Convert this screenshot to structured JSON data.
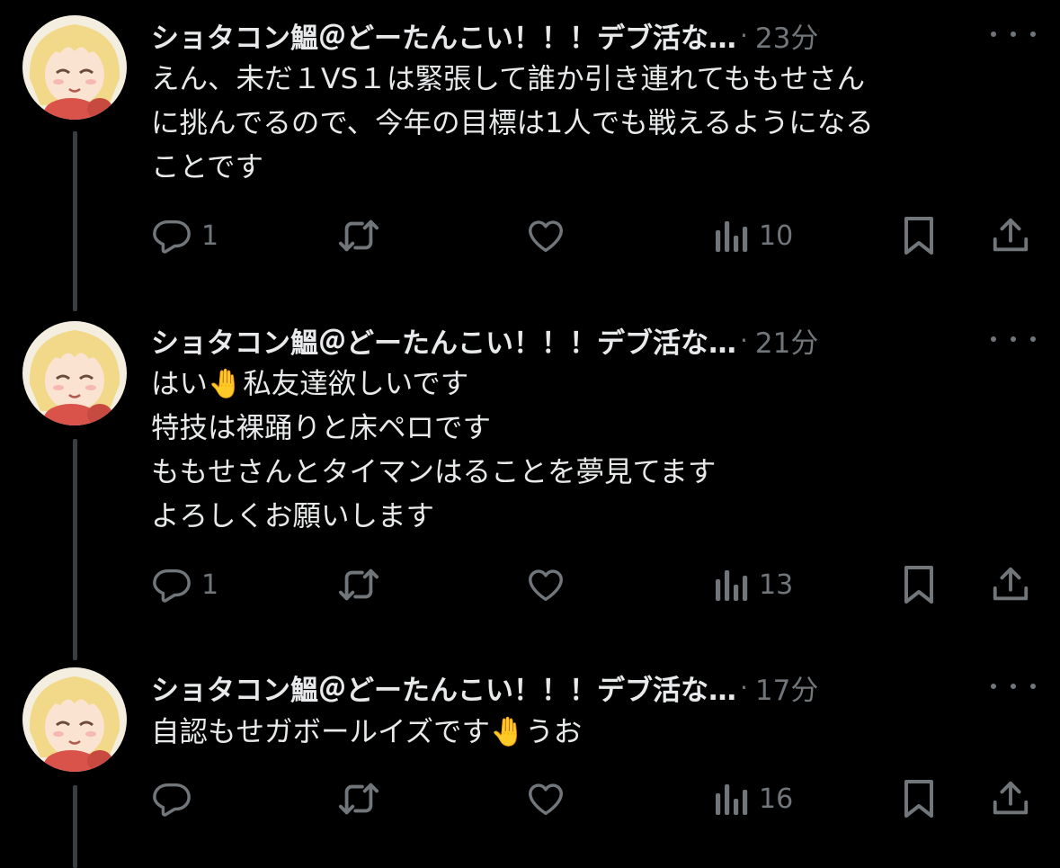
{
  "posts": [
    {
      "name": "ショタコン鰮＠どーたんこい！！！デブ活な…",
      "time": "23分",
      "lines": [
        "えん、未だ１VS１は緊張して誰か引き連れてももせさん",
        "に挑んでるので、今年の目標は1人でも戦えるようになる",
        "ことです"
      ],
      "replies": "1",
      "retweets": "",
      "likes": "",
      "views": "10"
    },
    {
      "name": "ショタコン鰮＠どーたんこい！！！デブ活な…",
      "time": "21分",
      "lines": [
        "はい🤚私友達欲しいです",
        "特技は裸踊りと床ペロです",
        "ももせさんとタイマンはることを夢見てます",
        "よろしくお願いします"
      ],
      "replies": "1",
      "retweets": "",
      "likes": "",
      "views": "13"
    },
    {
      "name": "ショタコン鰮＠どーたんこい！！！デブ活な…",
      "time": "17分",
      "lines": [
        "自認もせガボールイズです🤚うお"
      ],
      "replies": "",
      "retweets": "",
      "likes": "",
      "views": "16"
    }
  ],
  "icons": {
    "reply": "speech-bubble-icon",
    "retweet": "repost-arrows-icon",
    "like": "heart-icon",
    "views": "bar-chart-icon",
    "bookmark": "bookmark-icon",
    "share": "share-upload-icon",
    "more": "more-dots-icon"
  },
  "colors": {
    "background": "#000000",
    "text": "#e7e9ea",
    "secondary": "#71767b",
    "thread_line": "#3a3d41"
  }
}
